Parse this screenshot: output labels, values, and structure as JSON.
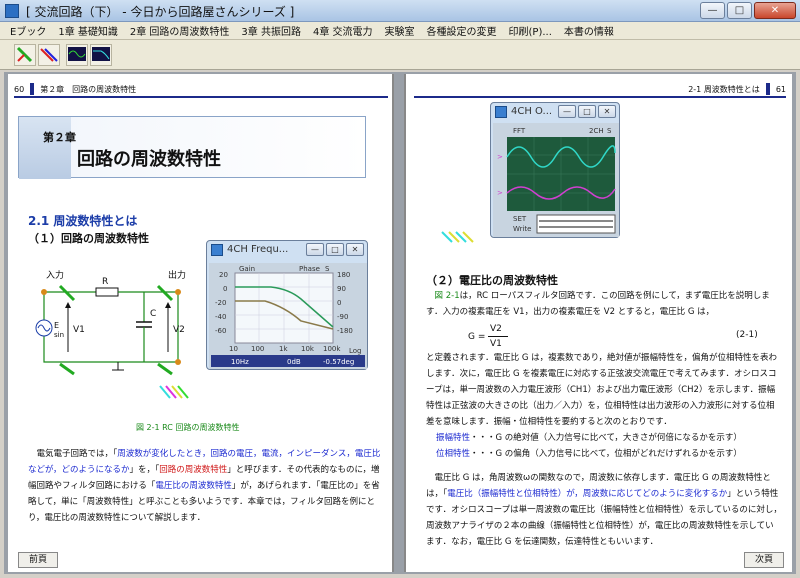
{
  "window": {
    "title": "[ 交流回路（下） - 今日から回路屋さんシリーズ ]",
    "buttons": {
      "minimize": "—",
      "maximize": "□",
      "close": "✕"
    }
  },
  "menu": {
    "items": [
      "Eブック",
      "1章 基礎知識",
      "2章 回路の周波数特性",
      "3章 共振回路",
      "4章 交流電力",
      "実験室",
      "各種設定の変更",
      "印刷(P)...",
      "本書の情報"
    ]
  },
  "toolbar": {
    "icons": [
      "probe-icon",
      "multi-probe-icon",
      "oscilloscope-icon",
      "analyzer-icon"
    ]
  },
  "left_page": {
    "header_number": "60",
    "header_text": "第２章　回路の周波数特性",
    "chapter_label": "第２章",
    "chapter_title": "回路の周波数特性",
    "section_title": "2.1  周波数特性とは",
    "subsection_title": "（１）回路の周波数特性",
    "circuit": {
      "input_label": "入力",
      "output_label": "出力",
      "resistor_label": "R",
      "capacitor_label": "C",
      "source_label_e": "E",
      "source_label_sin": "sin",
      "v1_label": "V1",
      "v2_label": "V2"
    },
    "figure_caption": "図 2-1  RC 回路の周波数特性",
    "paragraph_parts": [
      {
        "text": "　電気電子回路では，「",
        "style": ""
      },
      {
        "text": "周波数が変化したとき，回路の電圧，電流，インピーダンス，電圧比などが，どのようになるか",
        "style": "blue"
      },
      {
        "text": "」を，「",
        "style": ""
      },
      {
        "text": "回路の周波数特性",
        "style": "red"
      },
      {
        "text": "」と呼びます．その代表的なものに，増幅回路やフィルタ回路における「",
        "style": ""
      },
      {
        "text": "電圧比の周波数特性",
        "style": "blue"
      },
      {
        "text": "」が，あげられます．「電圧比の」を省略して，単に「周波数特性」と呼ぶことも多いようです．本章では，フィルタ回路を例にとり，電圧比の周波数特性について解説します．",
        "style": ""
      }
    ],
    "prev_button": "前頁"
  },
  "analyzer_window": {
    "title": "4CH Frequ...",
    "gain_label": "Gain",
    "phase_label": "Phase",
    "s_label": "S",
    "y_left_ticks": [
      "20",
      "0",
      "-20",
      "-40",
      "-60"
    ],
    "y_right_ticks": [
      "180",
      "90",
      "0",
      "-90",
      "-180"
    ],
    "x_ticks": [
      "10",
      "100",
      "1k",
      "10k",
      "100k"
    ],
    "log_label": "Log",
    "readout_freq": "10Hz",
    "readout_gain": "0dB",
    "readout_phase": "-0.57deg"
  },
  "scope_window": {
    "title": "4CH O...",
    "fft_label": "FFT",
    "twoch_label": "2CH",
    "s_label": "S",
    "set_label": "SET",
    "write_label": "Write"
  },
  "right_page": {
    "header_text": "2-1  周波数特性とは",
    "header_number": "61",
    "subsection_title": "（２）電圧比の周波数特性",
    "para1_parts": [
      {
        "text": "　",
        "style": ""
      },
      {
        "text": "図 2-1",
        "style": "green"
      },
      {
        "text": "は，RC ローパスフィルタ回路です．この回路を例にして，まず電圧比を説明します．入力の複素電圧を V1，出力の複素電圧を V2 とすると，電圧比 G は，",
        "style": ""
      }
    ],
    "formula_lhs": "G =",
    "formula_num": "V2",
    "formula_den": "V1",
    "formula_no": "(2-1)",
    "para2": "と定義されます．電圧比 G は，複素数であり，絶対値が振幅特性を，偏角が位相特性を表わします．次に，電圧比 G を複素電圧に対応する正弦波交流電圧で考えてみます．オシロスコープは，単一周波数の入力電圧波形（CH1）および出力電圧波形（CH2）を示します．振幅特性は正弦波の大きさの比（出力／入力）を，位相特性は出力波形の入力波形に対する位相差を意味します．振幅・位相特性を要約すると次のとおりです．",
    "list1_label": "振幅特性",
    "list1_text": "・・・G の絶対値（入力信号に比べて，大きさが何倍になるかを示す）",
    "list2_label": "位相特性",
    "list2_text": "・・・G の偏角（入力信号に比べて，位相がどれだけずれるかを示す）",
    "para3_parts": [
      {
        "text": "　電圧比 G は，角周波数ωの関数なので，周波数に依存します．電圧比 G の周波数特性とは，「",
        "style": ""
      },
      {
        "text": "電圧比（振幅特性と位相特性）が，周波数に応じてどのように変化するか",
        "style": "blue"
      },
      {
        "text": "」という特性です．オシロスコープは単一周波数の電圧比（振幅特性と位相特性）を示しているのに対し，周波数アナライザの２本の曲線（振幅特性と位相特性）が，電圧比の周波数特性を示しています．なお，電圧比 G を伝達関数，伝達特性ともいいます．",
        "style": ""
      }
    ],
    "next_button": "次頁"
  },
  "colors": {
    "accent_blue": "#1c2a8a",
    "scope_bg": "#1e5a3c",
    "trace_cyan": "#30d8c8",
    "trace_magenta": "#d040d0"
  }
}
